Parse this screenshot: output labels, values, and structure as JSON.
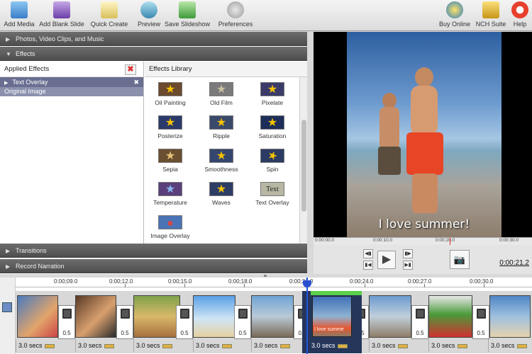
{
  "toolbar": {
    "left": [
      {
        "label": "Add Media",
        "icon": "add-media-icon"
      },
      {
        "label": "Add Blank Slide",
        "icon": "add-blank-slide-icon"
      },
      {
        "label": "Quick Create",
        "icon": "quick-create-icon"
      },
      {
        "label": "Preview",
        "icon": "preview-icon"
      },
      {
        "label": "Save Slideshow",
        "icon": "save-slideshow-icon"
      },
      {
        "label": "Preferences",
        "icon": "preferences-icon"
      }
    ],
    "right": [
      {
        "label": "Buy Online",
        "icon": "buy-online-icon"
      },
      {
        "label": "NCH Suite",
        "icon": "nch-suite-icon"
      },
      {
        "label": "Help",
        "icon": "help-icon"
      }
    ]
  },
  "sections": {
    "photos": "Photos, Video Clips, and Music",
    "effects": "Effects",
    "transitions": "Transitions",
    "narration": "Record Narration"
  },
  "applied": {
    "title": "Applied Effects",
    "items": [
      "Text Overlay"
    ],
    "original": "Original Image"
  },
  "library": {
    "title": "Effects Library",
    "effects": [
      "Oil Painting",
      "Old Film",
      "Pixelate",
      "Posterize",
      "Ripple",
      "Saturation",
      "Sepia",
      "Smoothness",
      "Spin",
      "Temperature",
      "Waves",
      "Text Overlay",
      "Image Overlay"
    ],
    "text_thumb": "Text"
  },
  "preview": {
    "caption": "I love summer!",
    "ruler": [
      "0:00:00.0",
      "0:00:10.0",
      "0:00:20.0",
      "0:00:30.0"
    ],
    "time": "0:00:21.2"
  },
  "timeline": {
    "ticks": [
      "0:00;09.0",
      "0:00;12.0",
      "0:00;15.0",
      "0:00;18.0",
      "0:00;21.0",
      "0:00;24.0",
      "0:00;27.0",
      "0:00;30.0"
    ],
    "transition_label": "0.5",
    "duration_label": "3.0 secs",
    "selected_caption": "I love summe"
  },
  "colors": {
    "selection_bar": "#6a6f91",
    "playhead": "#2255dd",
    "green_marker": "#5bd04a"
  }
}
